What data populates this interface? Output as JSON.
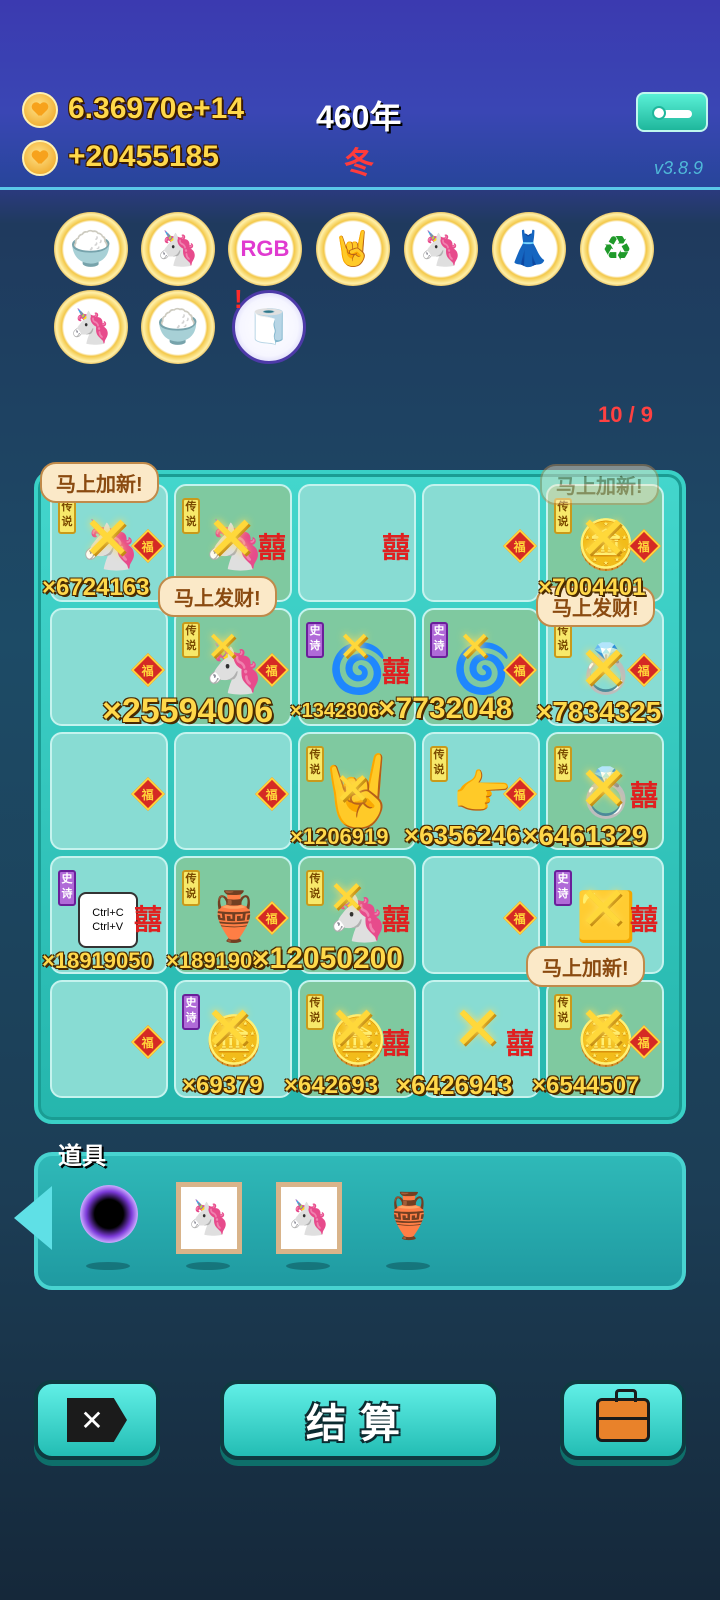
{
  "hud": {
    "coins": "6.36970e+14",
    "income": "+20455185",
    "year": "460年",
    "season": "冬",
    "version": "v3.8.9"
  },
  "relics": [
    {
      "icon": "rice-bowls-icon",
      "glyph": "🍚"
    },
    {
      "icon": "unicorn-icon",
      "glyph": "🦄"
    },
    {
      "icon": "rgb-icon",
      "glyph": "RGB"
    },
    {
      "icon": "rock-hand-icon",
      "glyph": "🤘"
    },
    {
      "icon": "unicorn-icon",
      "glyph": "🦄"
    },
    {
      "icon": "skirt-icon",
      "glyph": "👗"
    },
    {
      "icon": "recycle-icon",
      "glyph": "♻"
    },
    {
      "icon": "unicorn-icon",
      "glyph": "🦄"
    },
    {
      "icon": "rice-bowls-icon",
      "glyph": "🍚"
    },
    {
      "icon": "tissue-box-icon",
      "glyph": "🧻"
    }
  ],
  "relic_alert": "!",
  "turn_counter": "10 / 9",
  "board": {
    "tags": {
      "legend": "传说",
      "epic": "史诗"
    },
    "fu": "福",
    "xi": "囍",
    "bubbles": [
      "马上加新!",
      "马上发财!",
      "马上加新!",
      "马上发财!",
      "马上加新!"
    ],
    "multipliers": [
      "×6724163",
      "×7004401",
      "×25594006",
      "×1342806",
      "×7732048",
      "×7834325",
      "×1206919",
      "×6356246",
      "×6461329",
      "×18919050",
      "×1891905",
      "×12050200",
      "×69379",
      "×642693",
      "×6426943",
      "×6544507"
    ]
  },
  "props": {
    "title": "道具",
    "items": [
      {
        "icon": "black-hole-icon"
      },
      {
        "icon": "unicorn-painting-icon",
        "glyph": "🦄"
      },
      {
        "icon": "unicorn-painting-icon",
        "glyph": "🦄"
      },
      {
        "icon": "green-vase-icon",
        "glyph": "🏺"
      }
    ]
  },
  "buttons": {
    "settle": "结算",
    "delete_icon": "✕"
  },
  "cell_items": {
    "copy_paste": "Ctrl+C\nCtrl+V"
  }
}
